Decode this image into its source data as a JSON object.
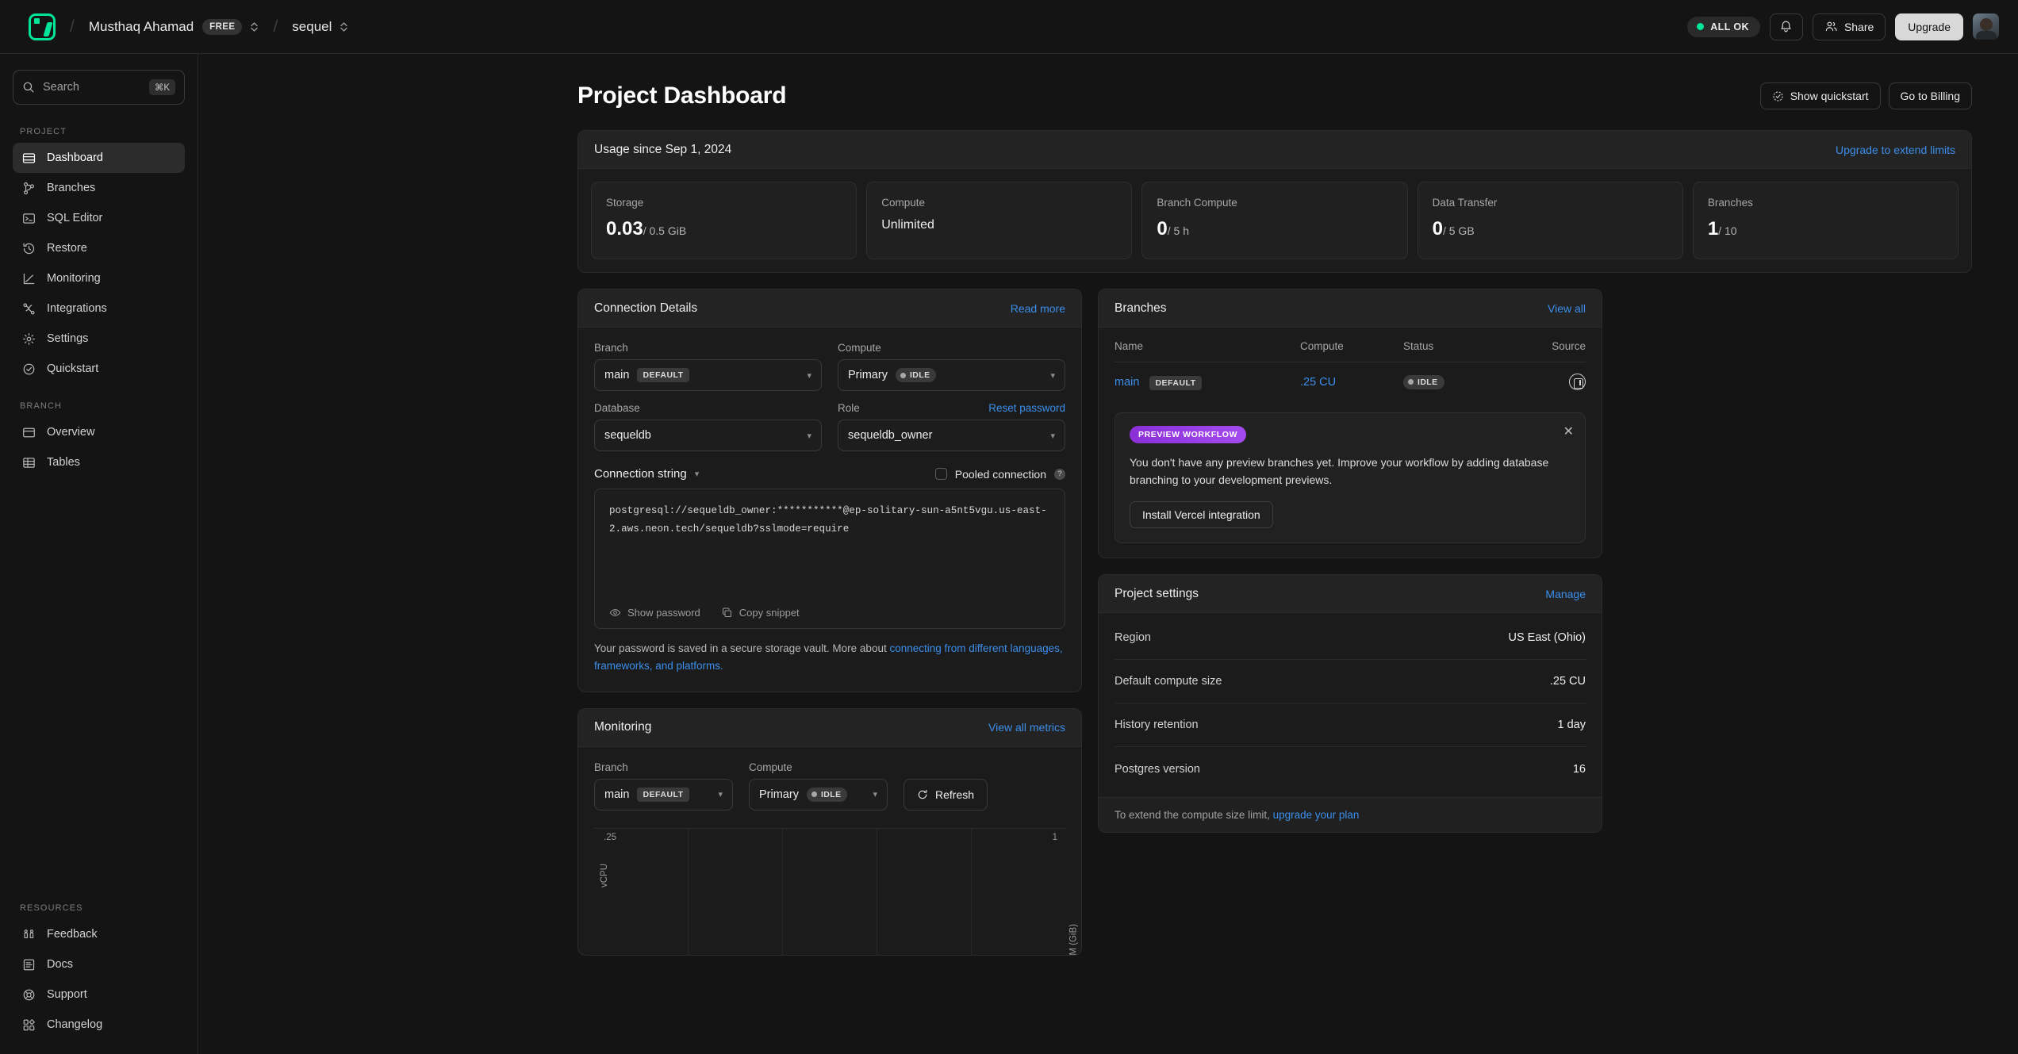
{
  "topbar": {
    "logo": "neon-logo",
    "account_name": "Musthaq Ahamad",
    "plan_badge": "FREE",
    "project_name": "sequel",
    "status_label": "ALL OK",
    "notifications_icon": "bell-icon",
    "share_label": "Share",
    "upgrade_label": "Upgrade",
    "avatar": "user-avatar"
  },
  "sidebar": {
    "search": {
      "placeholder": "Search",
      "shortcut": "⌘K"
    },
    "sections": [
      {
        "label": "PROJECT",
        "items": [
          {
            "label": "Dashboard",
            "icon": "dashboard-icon",
            "active": true
          },
          {
            "label": "Branches",
            "icon": "branch-icon",
            "active": false
          },
          {
            "label": "SQL Editor",
            "icon": "terminal-icon",
            "active": false
          },
          {
            "label": "Restore",
            "icon": "history-icon",
            "active": false
          },
          {
            "label": "Monitoring",
            "icon": "chart-line-icon",
            "active": false
          },
          {
            "label": "Integrations",
            "icon": "integrations-icon",
            "active": false
          },
          {
            "label": "Settings",
            "icon": "gear-icon",
            "active": false
          },
          {
            "label": "Quickstart",
            "icon": "check-circle-icon",
            "active": false
          }
        ]
      },
      {
        "label": "BRANCH",
        "items": [
          {
            "label": "Overview",
            "icon": "overview-icon",
            "active": false
          },
          {
            "label": "Tables",
            "icon": "table-icon",
            "active": false
          }
        ]
      }
    ],
    "resources": {
      "label": "RESOURCES",
      "items": [
        {
          "label": "Feedback",
          "icon": "feedback-icon"
        },
        {
          "label": "Docs",
          "icon": "docs-icon"
        },
        {
          "label": "Support",
          "icon": "lifebuoy-icon"
        },
        {
          "label": "Changelog",
          "icon": "changelog-icon"
        }
      ]
    }
  },
  "page": {
    "title": "Project Dashboard",
    "show_quickstart_label": "Show quickstart",
    "go_to_billing_label": "Go to Billing"
  },
  "usage": {
    "header": "Usage since Sep 1, 2024",
    "upgrade_link": "Upgrade to extend limits",
    "cards": [
      {
        "label": "Storage",
        "value": "0.03",
        "sub": "/ 0.5 GiB",
        "plain": false
      },
      {
        "label": "Compute",
        "value": "Unlimited",
        "sub": "",
        "plain": true
      },
      {
        "label": "Branch Compute",
        "value": "0",
        "sub": "/ 5 h",
        "plain": false
      },
      {
        "label": "Data Transfer",
        "value": "0",
        "sub": "/ 5 GB",
        "plain": false
      },
      {
        "label": "Branches",
        "value": "1",
        "sub": "/ 10",
        "plain": false
      }
    ]
  },
  "connection_details": {
    "title": "Connection Details",
    "read_more_label": "Read more",
    "branch_label": "Branch",
    "branch_value": "main",
    "branch_tag": "DEFAULT",
    "compute_label": "Compute",
    "compute_value": "Primary",
    "compute_status": "IDLE",
    "database_label": "Database",
    "database_value": "sequeldb",
    "role_label": "Role",
    "role_value": "sequeldb_owner",
    "reset_password_label": "Reset password",
    "connection_string_label": "Connection string",
    "pooled_label": "Pooled connection",
    "pooled_checked": false,
    "help_icon_glyph": "?",
    "connection_string": "postgresql://sequeldb_owner:***********@ep-solitary-sun-a5nt5vgu.us-east-2.aws.neon.tech/sequeldb?sslmode=require",
    "show_password_label": "Show password",
    "copy_snippet_label": "Copy snippet",
    "note_prefix": "Your password is saved in a secure storage vault. More about ",
    "note_link": "connecting from different languages, frameworks, and platforms."
  },
  "branches": {
    "title": "Branches",
    "view_all_label": "View all",
    "columns": [
      "Name",
      "Compute",
      "Status",
      "Source"
    ],
    "rows": [
      {
        "name": "main",
        "tag": "DEFAULT",
        "compute": ".25 CU",
        "status": "IDLE",
        "source_icon": "neon-source-icon"
      }
    ]
  },
  "preview_workflow": {
    "badge": "PREVIEW WORKFLOW",
    "close_icon": "close-icon",
    "text": "You don't have any preview branches yet. Improve your workflow by adding database branching to your development previews.",
    "button_label": "Install Vercel integration",
    "badge_color": "#a44bf0"
  },
  "project_settings": {
    "title": "Project settings",
    "manage_label": "Manage",
    "rows": [
      {
        "key": "Region",
        "value": "US East (Ohio)"
      },
      {
        "key": "Default compute size",
        "value": ".25 CU"
      },
      {
        "key": "History retention",
        "value": "1 day"
      },
      {
        "key": "Postgres version",
        "value": "16"
      }
    ],
    "footer_prefix": "To extend the compute size limit, ",
    "footer_link": "upgrade your plan"
  },
  "monitoring": {
    "title": "Monitoring",
    "view_all_metrics_label": "View all metrics",
    "branch_label": "Branch",
    "branch_value": "main",
    "branch_tag": "DEFAULT",
    "compute_label": "Compute",
    "compute_value": "Primary",
    "compute_status": "IDLE",
    "refresh_label": "Refresh",
    "refresh_icon": "refresh-icon"
  },
  "chart_data": {
    "type": "line",
    "title": "",
    "series": [
      {
        "name": "vCPU",
        "values": []
      },
      {
        "name": "RAM (GiB)",
        "values": []
      }
    ],
    "x": [],
    "xlabel": "",
    "ylabel": "vCPU",
    "y2label": "RAM (GiB)",
    "ylim": [
      0,
      0.25
    ],
    "y2lim": [
      0,
      1
    ],
    "ytick_label": ".25",
    "y2tick_label": "1",
    "grid": true,
    "gridline_count": 5,
    "legend": "none",
    "note": "empty chart - no data plotted"
  },
  "colors": {
    "accent_link": "#3b8eea",
    "brand_green": "#00e599",
    "page_bg": "#141414",
    "panel_bg": "#1b1b1b",
    "panel_header_bg": "#232323",
    "card_bg": "#202020",
    "border": "#2e2e2e"
  }
}
